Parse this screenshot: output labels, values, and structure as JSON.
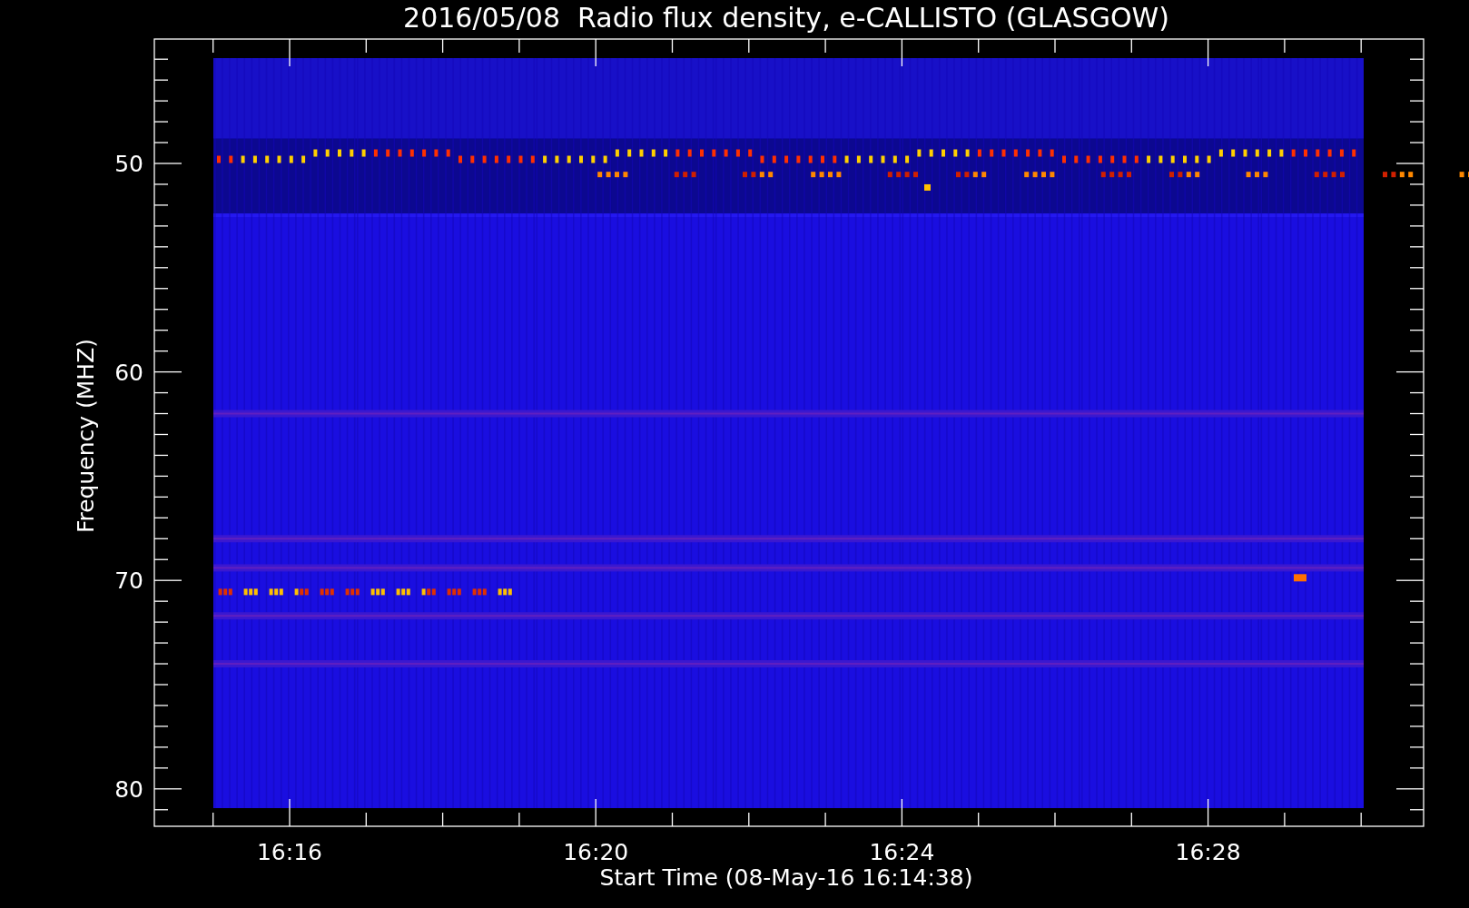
{
  "title": "2016/05/08  Radio flux density, e-CALLISTO (GLASGOW)",
  "y_axis": {
    "label": "Frequency (MHZ)",
    "ticks": [
      "50",
      "60",
      "70",
      "80"
    ]
  },
  "x_axis": {
    "label": "Start Time (08-May-16 16:14:38)",
    "ticks": [
      "16:16",
      "16:20",
      "16:24",
      "16:28"
    ]
  }
}
